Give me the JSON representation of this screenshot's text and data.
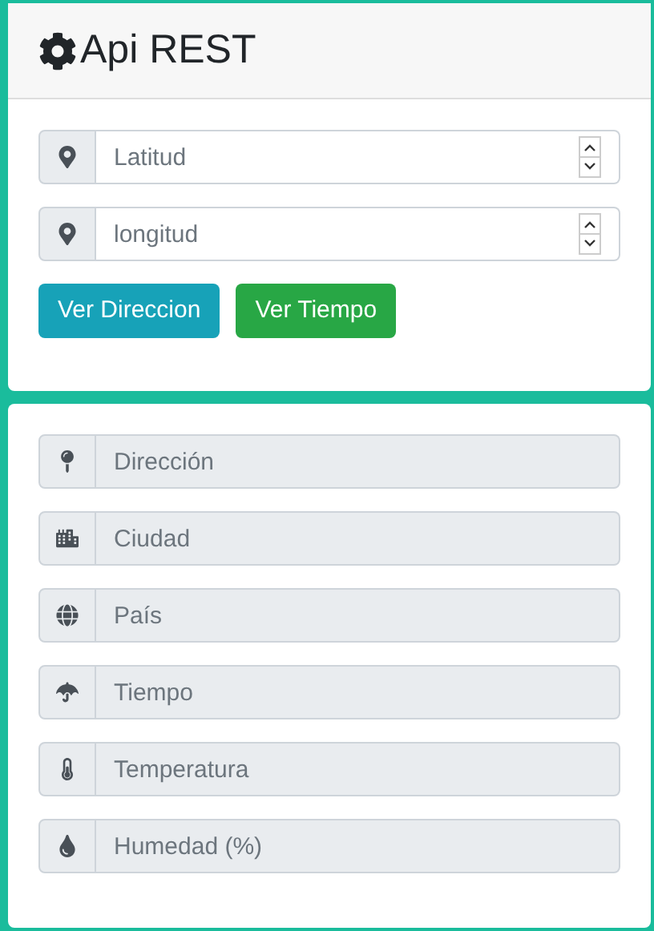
{
  "header": {
    "title": "Api REST"
  },
  "inputs": [
    {
      "placeholder": "Latitud",
      "disabled": false
    },
    {
      "placeholder": "longitud",
      "disabled": false
    }
  ],
  "buttons": [
    {
      "label": "Ver Direccion",
      "color": "#17a2b8"
    },
    {
      "label": "Ver Tiempo",
      "color": "#28a745"
    }
  ],
  "results": [
    {
      "placeholder": "Dirección",
      "disabled": true
    },
    {
      "placeholder": "Ciudad",
      "disabled": true
    },
    {
      "placeholder": "País",
      "disabled": true
    },
    {
      "placeholder": "Tiempo",
      "disabled": true
    },
    {
      "placeholder": "Temperatura",
      "disabled": true
    },
    {
      "placeholder": "Humedad (%)",
      "disabled": true
    }
  ]
}
